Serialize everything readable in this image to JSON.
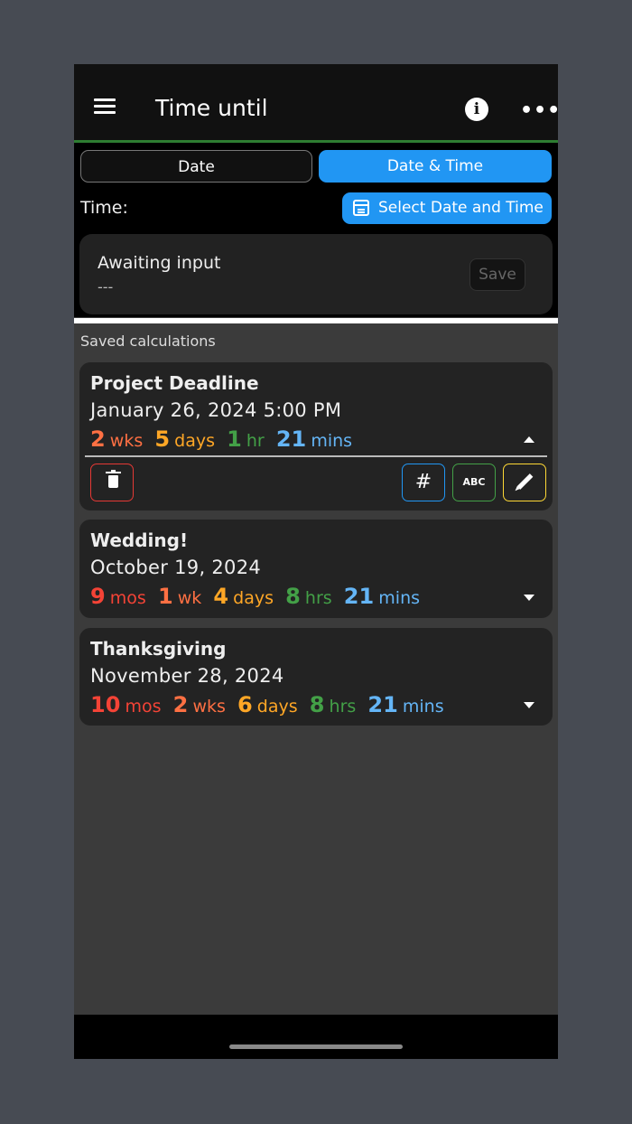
{
  "app_bar": {
    "title": "Time until"
  },
  "mode_tabs": [
    {
      "label": "Date",
      "selected": false
    },
    {
      "label": "Date & Time",
      "selected": true
    }
  ],
  "time_row": {
    "label": "Time:",
    "select_button": "Select Date and Time"
  },
  "result": {
    "status": "Awaiting input",
    "value": "---",
    "save_label": "Save"
  },
  "saved_section": {
    "label": "Saved calculations"
  },
  "saved": [
    {
      "title": "Project Deadline",
      "date": "January 26, 2024 5:00 PM",
      "expanded": true,
      "duration": [
        {
          "n": "2",
          "u": "wks",
          "color": "#ff7043"
        },
        {
          "n": "5",
          "u": "days",
          "color": "#ffa726"
        },
        {
          "n": "1",
          "u": "hr",
          "color": "#43a047"
        },
        {
          "n": "21",
          "u": "mins",
          "color": "#64b5f6"
        }
      ],
      "actions": {
        "numeric_icon": "#",
        "text_icon": "ABC"
      }
    },
    {
      "title": "Wedding!",
      "date": "October 19, 2024",
      "expanded": false,
      "duration": [
        {
          "n": "9",
          "u": "mos",
          "color": "#f44336"
        },
        {
          "n": "1",
          "u": "wk",
          "color": "#ff7043"
        },
        {
          "n": "4",
          "u": "days",
          "color": "#ffa726"
        },
        {
          "n": "8",
          "u": "hrs",
          "color": "#43a047"
        },
        {
          "n": "21",
          "u": "mins",
          "color": "#64b5f6"
        }
      ]
    },
    {
      "title": "Thanksgiving",
      "date": "November 28, 2024",
      "expanded": false,
      "duration": [
        {
          "n": "10",
          "u": "mos",
          "color": "#f44336"
        },
        {
          "n": "2",
          "u": "wks",
          "color": "#ff7043"
        },
        {
          "n": "6",
          "u": "days",
          "color": "#ffa726"
        },
        {
          "n": "8",
          "u": "hrs",
          "color": "#43a047"
        },
        {
          "n": "21",
          "u": "mins",
          "color": "#64b5f6"
        }
      ]
    }
  ],
  "colors": {
    "accent": "#2196f3",
    "appbar_underline": "#2e7d32",
    "delete": "#e53935",
    "edit": "#fdd835"
  }
}
